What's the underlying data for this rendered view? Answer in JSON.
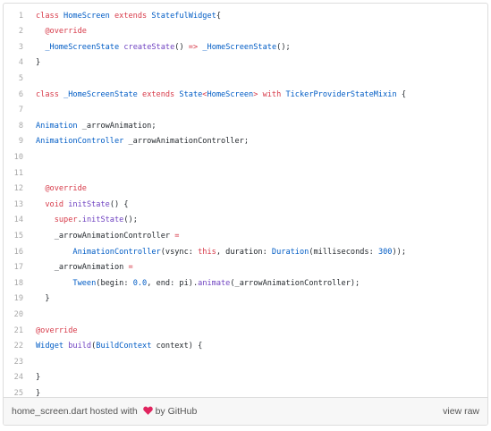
{
  "colors": {
    "keyword": "#d73a49",
    "type": "#005cc5",
    "function": "#6f42c1",
    "plain": "#24292e",
    "line_number": "#a8a8a8",
    "heart": "#e0245e"
  },
  "lines": [
    {
      "n": "1",
      "tokens": [
        [
          "k",
          "class "
        ],
        [
          "t",
          "HomeScreen"
        ],
        [
          "k",
          " extends "
        ],
        [
          "t",
          "StatefulWidget"
        ],
        [
          "",
          "{"
        ]
      ]
    },
    {
      "n": "2",
      "tokens": [
        [
          "",
          "  "
        ],
        [
          "k",
          "@override"
        ]
      ]
    },
    {
      "n": "3",
      "tokens": [
        [
          "",
          "  "
        ],
        [
          "t",
          "_HomeScreenState"
        ],
        [
          "",
          " "
        ],
        [
          "f",
          "createState"
        ],
        [
          "",
          "() "
        ],
        [
          "k",
          "=>"
        ],
        [
          "",
          " "
        ],
        [
          "t",
          "_HomeScreenState"
        ],
        [
          "",
          "();"
        ]
      ]
    },
    {
      "n": "4",
      "tokens": [
        [
          "",
          "}"
        ]
      ]
    },
    {
      "n": "5",
      "tokens": []
    },
    {
      "n": "6",
      "tokens": [
        [
          "k",
          "class "
        ],
        [
          "t",
          "_HomeScreenState"
        ],
        [
          "k",
          " extends "
        ],
        [
          "t",
          "State"
        ],
        [
          "k",
          "<"
        ],
        [
          "t",
          "HomeScreen"
        ],
        [
          "k",
          "> with "
        ],
        [
          "t",
          "TickerProviderStateMixin"
        ],
        [
          "",
          " {"
        ]
      ]
    },
    {
      "n": "7",
      "tokens": []
    },
    {
      "n": "8",
      "tokens": [
        [
          "t",
          "Animation"
        ],
        [
          "",
          " _arrowAnimation;"
        ]
      ]
    },
    {
      "n": "9",
      "tokens": [
        [
          "t",
          "AnimationController"
        ],
        [
          "",
          " _arrowAnimationController;"
        ]
      ]
    },
    {
      "n": "10",
      "tokens": []
    },
    {
      "n": "11",
      "tokens": []
    },
    {
      "n": "12",
      "tokens": [
        [
          "",
          "  "
        ],
        [
          "k",
          "@override"
        ]
      ]
    },
    {
      "n": "13",
      "tokens": [
        [
          "",
          "  "
        ],
        [
          "k",
          "void"
        ],
        [
          "",
          " "
        ],
        [
          "f",
          "initState"
        ],
        [
          "",
          "() {"
        ]
      ]
    },
    {
      "n": "14",
      "tokens": [
        [
          "",
          "    "
        ],
        [
          "k",
          "super"
        ],
        [
          "",
          "."
        ],
        [
          "f",
          "initState"
        ],
        [
          "",
          "();"
        ]
      ]
    },
    {
      "n": "15",
      "tokens": [
        [
          "",
          "    _arrowAnimationController "
        ],
        [
          "k",
          "="
        ]
      ]
    },
    {
      "n": "16",
      "tokens": [
        [
          "",
          "        "
        ],
        [
          "t",
          "AnimationController"
        ],
        [
          "",
          "(vsync: "
        ],
        [
          "k",
          "this"
        ],
        [
          "",
          ", duration: "
        ],
        [
          "t",
          "Duration"
        ],
        [
          "",
          "(milliseconds: "
        ],
        [
          "t",
          "300"
        ],
        [
          "",
          "));"
        ]
      ]
    },
    {
      "n": "17",
      "tokens": [
        [
          "",
          "    _arrowAnimation "
        ],
        [
          "k",
          "="
        ]
      ]
    },
    {
      "n": "18",
      "tokens": [
        [
          "",
          "        "
        ],
        [
          "t",
          "Tween"
        ],
        [
          "",
          "(begin: "
        ],
        [
          "t",
          "0.0"
        ],
        [
          "",
          ", end: pi)."
        ],
        [
          "f",
          "animate"
        ],
        [
          "",
          "(_arrowAnimationController);"
        ]
      ]
    },
    {
      "n": "19",
      "tokens": [
        [
          "",
          "  }"
        ]
      ]
    },
    {
      "n": "20",
      "tokens": []
    },
    {
      "n": "21",
      "tokens": [
        [
          "k",
          "@override"
        ]
      ]
    },
    {
      "n": "22",
      "tokens": [
        [
          "t",
          "Widget"
        ],
        [
          "",
          " "
        ],
        [
          "f",
          "build"
        ],
        [
          "",
          "("
        ],
        [
          "t",
          "BuildContext"
        ],
        [
          "",
          " context) {"
        ]
      ]
    },
    {
      "n": "23",
      "tokens": []
    },
    {
      "n": "24",
      "tokens": [
        [
          "",
          "}"
        ]
      ]
    },
    {
      "n": "25",
      "tokens": [
        [
          "",
          "}"
        ]
      ]
    }
  ],
  "footer": {
    "filename": "home_screen.dart",
    "hosted_with": " hosted with ",
    "by": "by GitHub",
    "view_raw": "view raw"
  }
}
